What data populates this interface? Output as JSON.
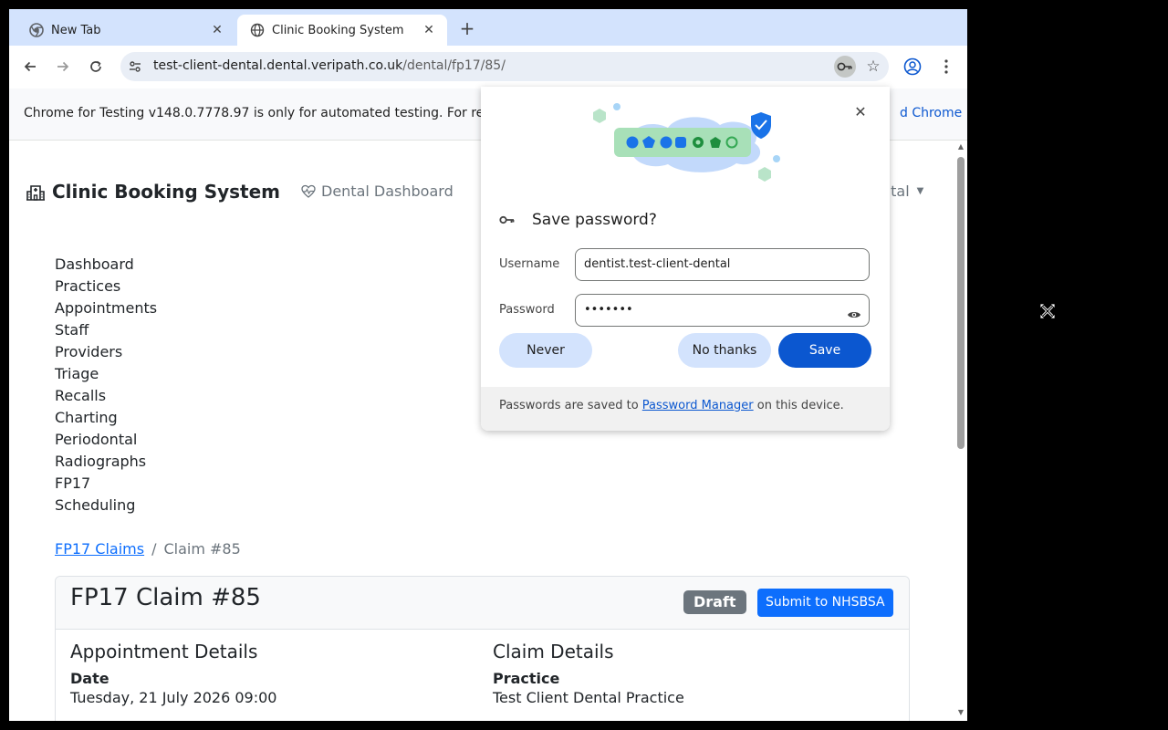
{
  "browser": {
    "tabs": [
      {
        "title": "New Tab",
        "active": false,
        "icon": "chrome-icon"
      },
      {
        "title": "Clinic Booking System",
        "active": true,
        "icon": "globe-icon"
      }
    ],
    "url_host": "test-client-dental.dental.veripath.co.uk",
    "url_path": "/dental/fp17/85/",
    "infobar_message": "Chrome for Testing v148.0.7778.97 is only for automated testing. For re",
    "infobar_link": "d Chrome"
  },
  "app": {
    "brand": "Clinic Booking System",
    "nav_dashboard": "Dental Dashboard",
    "user_dropdown": "ntal",
    "sidebar": [
      {
        "label": "Dashboard"
      },
      {
        "label": "Practices"
      },
      {
        "label": "Appointments"
      },
      {
        "label": "Staff"
      },
      {
        "label": "Providers"
      },
      {
        "label": "Triage"
      },
      {
        "label": "Recalls"
      },
      {
        "label": "Charting"
      },
      {
        "label": "Periodontal"
      },
      {
        "label": "Radiographs"
      },
      {
        "label": "FP17"
      },
      {
        "label": "Scheduling"
      }
    ],
    "breadcrumb": {
      "parent": "FP17 Claims",
      "current": "Claim #85"
    },
    "claim": {
      "title": "FP17 Claim #85",
      "status": "Draft",
      "submit_label": "Submit to NHSBSA",
      "appointment_heading": "Appointment Details",
      "date_label": "Date",
      "date_value": "Tuesday, 21 July 2026 09:00",
      "claim_heading": "Claim Details",
      "practice_label": "Practice",
      "practice_value": "Test Client Dental Practice"
    }
  },
  "password_popup": {
    "title": "Save password?",
    "username_label": "Username",
    "username_value": "dentist.test-client-dental",
    "password_label": "Password",
    "password_value": "•••••••",
    "never_label": "Never",
    "no_thanks_label": "No thanks",
    "save_label": "Save",
    "footer_prefix": "Passwords are saved to ",
    "footer_link": "Password Manager",
    "footer_suffix": " on this device."
  },
  "colors": {
    "primary": "#0d6efd",
    "chrome_blue": "#0b57d0",
    "badge_gray": "#6c757d"
  }
}
